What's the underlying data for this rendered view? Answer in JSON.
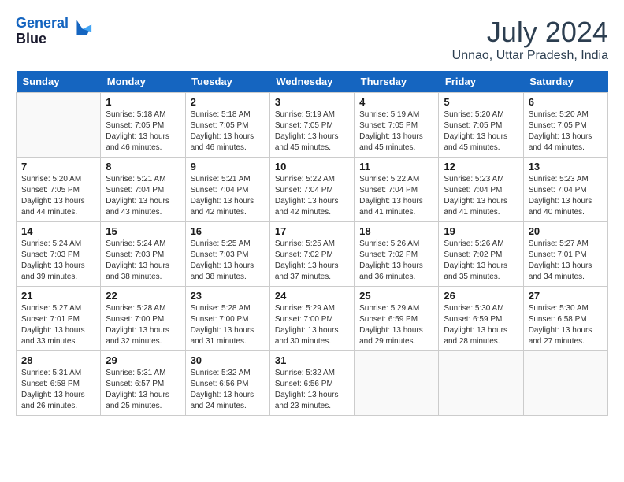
{
  "logo": {
    "line1": "General",
    "line2": "Blue"
  },
  "title": "July 2024",
  "location": "Unnao, Uttar Pradesh, India",
  "headers": [
    "Sunday",
    "Monday",
    "Tuesday",
    "Wednesday",
    "Thursday",
    "Friday",
    "Saturday"
  ],
  "weeks": [
    [
      {
        "day": "",
        "info": ""
      },
      {
        "day": "1",
        "info": "Sunrise: 5:18 AM\nSunset: 7:05 PM\nDaylight: 13 hours\nand 46 minutes."
      },
      {
        "day": "2",
        "info": "Sunrise: 5:18 AM\nSunset: 7:05 PM\nDaylight: 13 hours\nand 46 minutes."
      },
      {
        "day": "3",
        "info": "Sunrise: 5:19 AM\nSunset: 7:05 PM\nDaylight: 13 hours\nand 45 minutes."
      },
      {
        "day": "4",
        "info": "Sunrise: 5:19 AM\nSunset: 7:05 PM\nDaylight: 13 hours\nand 45 minutes."
      },
      {
        "day": "5",
        "info": "Sunrise: 5:20 AM\nSunset: 7:05 PM\nDaylight: 13 hours\nand 45 minutes."
      },
      {
        "day": "6",
        "info": "Sunrise: 5:20 AM\nSunset: 7:05 PM\nDaylight: 13 hours\nand 44 minutes."
      }
    ],
    [
      {
        "day": "7",
        "info": "Sunrise: 5:20 AM\nSunset: 7:05 PM\nDaylight: 13 hours\nand 44 minutes."
      },
      {
        "day": "8",
        "info": "Sunrise: 5:21 AM\nSunset: 7:04 PM\nDaylight: 13 hours\nand 43 minutes."
      },
      {
        "day": "9",
        "info": "Sunrise: 5:21 AM\nSunset: 7:04 PM\nDaylight: 13 hours\nand 42 minutes."
      },
      {
        "day": "10",
        "info": "Sunrise: 5:22 AM\nSunset: 7:04 PM\nDaylight: 13 hours\nand 42 minutes."
      },
      {
        "day": "11",
        "info": "Sunrise: 5:22 AM\nSunset: 7:04 PM\nDaylight: 13 hours\nand 41 minutes."
      },
      {
        "day": "12",
        "info": "Sunrise: 5:23 AM\nSunset: 7:04 PM\nDaylight: 13 hours\nand 41 minutes."
      },
      {
        "day": "13",
        "info": "Sunrise: 5:23 AM\nSunset: 7:04 PM\nDaylight: 13 hours\nand 40 minutes."
      }
    ],
    [
      {
        "day": "14",
        "info": "Sunrise: 5:24 AM\nSunset: 7:03 PM\nDaylight: 13 hours\nand 39 minutes."
      },
      {
        "day": "15",
        "info": "Sunrise: 5:24 AM\nSunset: 7:03 PM\nDaylight: 13 hours\nand 38 minutes."
      },
      {
        "day": "16",
        "info": "Sunrise: 5:25 AM\nSunset: 7:03 PM\nDaylight: 13 hours\nand 38 minutes."
      },
      {
        "day": "17",
        "info": "Sunrise: 5:25 AM\nSunset: 7:02 PM\nDaylight: 13 hours\nand 37 minutes."
      },
      {
        "day": "18",
        "info": "Sunrise: 5:26 AM\nSunset: 7:02 PM\nDaylight: 13 hours\nand 36 minutes."
      },
      {
        "day": "19",
        "info": "Sunrise: 5:26 AM\nSunset: 7:02 PM\nDaylight: 13 hours\nand 35 minutes."
      },
      {
        "day": "20",
        "info": "Sunrise: 5:27 AM\nSunset: 7:01 PM\nDaylight: 13 hours\nand 34 minutes."
      }
    ],
    [
      {
        "day": "21",
        "info": "Sunrise: 5:27 AM\nSunset: 7:01 PM\nDaylight: 13 hours\nand 33 minutes."
      },
      {
        "day": "22",
        "info": "Sunrise: 5:28 AM\nSunset: 7:00 PM\nDaylight: 13 hours\nand 32 minutes."
      },
      {
        "day": "23",
        "info": "Sunrise: 5:28 AM\nSunset: 7:00 PM\nDaylight: 13 hours\nand 31 minutes."
      },
      {
        "day": "24",
        "info": "Sunrise: 5:29 AM\nSunset: 7:00 PM\nDaylight: 13 hours\nand 30 minutes."
      },
      {
        "day": "25",
        "info": "Sunrise: 5:29 AM\nSunset: 6:59 PM\nDaylight: 13 hours\nand 29 minutes."
      },
      {
        "day": "26",
        "info": "Sunrise: 5:30 AM\nSunset: 6:59 PM\nDaylight: 13 hours\nand 28 minutes."
      },
      {
        "day": "27",
        "info": "Sunrise: 5:30 AM\nSunset: 6:58 PM\nDaylight: 13 hours\nand 27 minutes."
      }
    ],
    [
      {
        "day": "28",
        "info": "Sunrise: 5:31 AM\nSunset: 6:58 PM\nDaylight: 13 hours\nand 26 minutes."
      },
      {
        "day": "29",
        "info": "Sunrise: 5:31 AM\nSunset: 6:57 PM\nDaylight: 13 hours\nand 25 minutes."
      },
      {
        "day": "30",
        "info": "Sunrise: 5:32 AM\nSunset: 6:56 PM\nDaylight: 13 hours\nand 24 minutes."
      },
      {
        "day": "31",
        "info": "Sunrise: 5:32 AM\nSunset: 6:56 PM\nDaylight: 13 hours\nand 23 minutes."
      },
      {
        "day": "",
        "info": ""
      },
      {
        "day": "",
        "info": ""
      },
      {
        "day": "",
        "info": ""
      }
    ]
  ]
}
